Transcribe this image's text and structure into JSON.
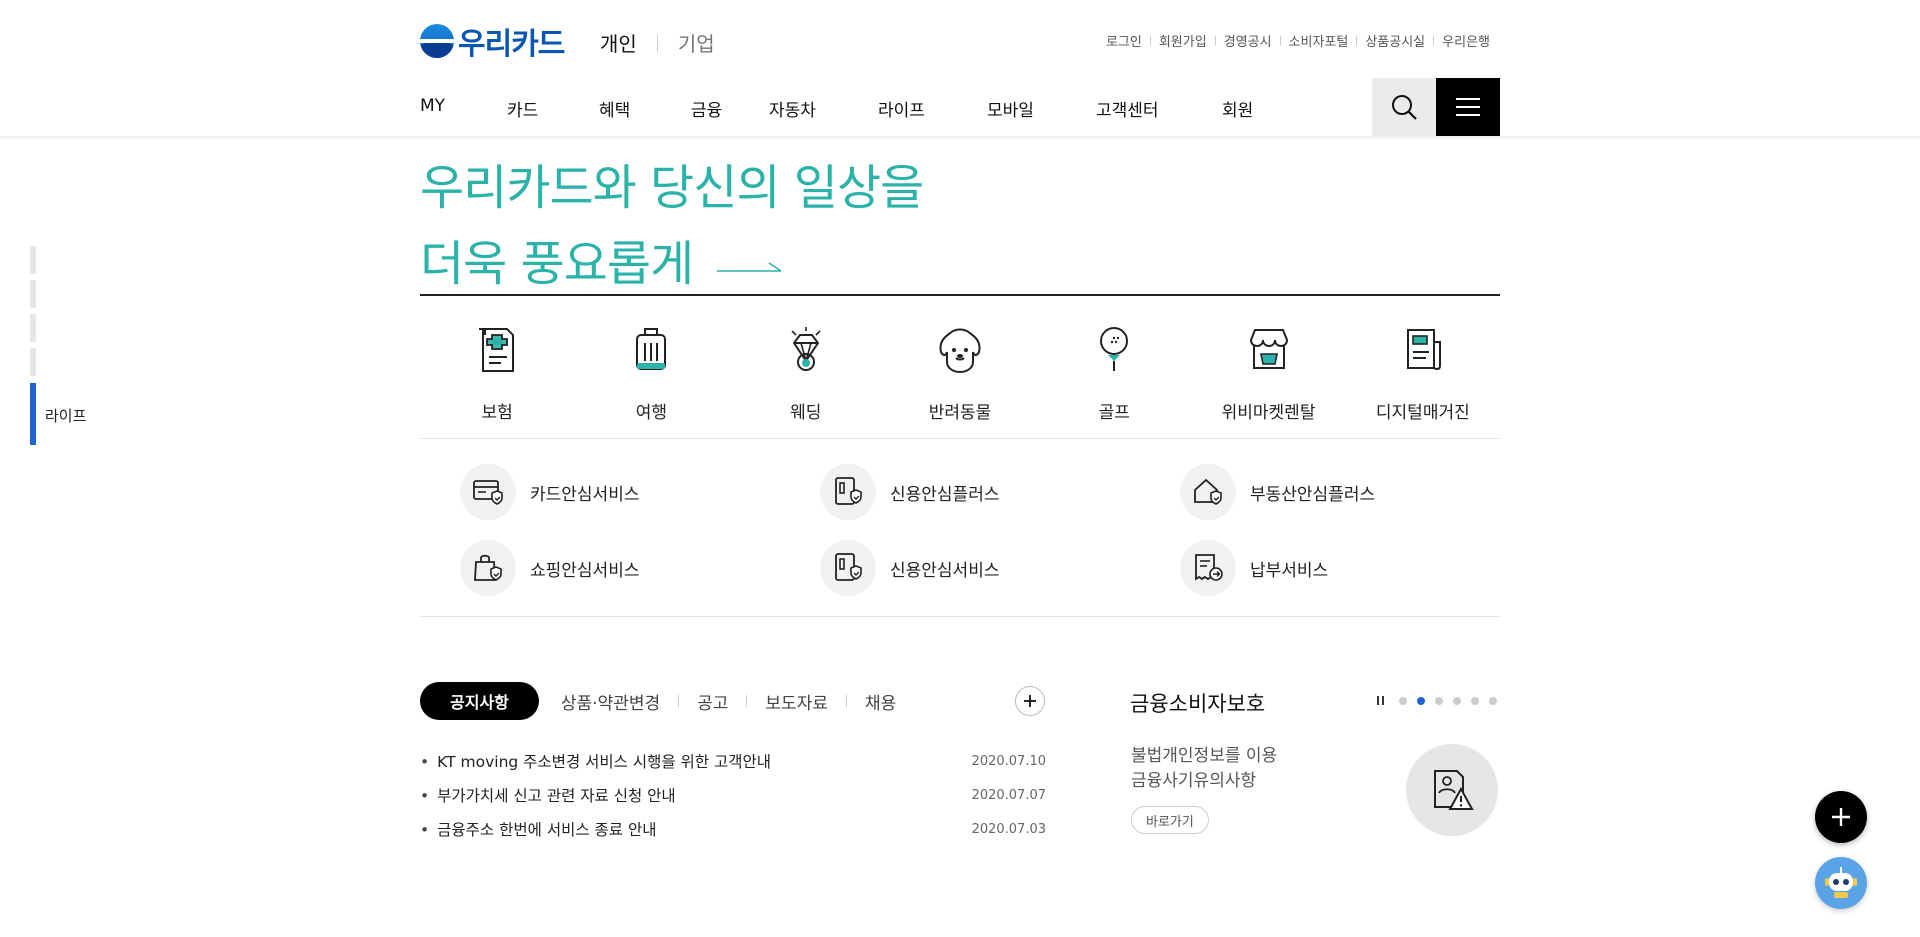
{
  "header": {
    "logo_text": "우리카드",
    "biz_tabs": {
      "personal": "개인",
      "corporate": "기업"
    },
    "util_nav": [
      "로그인",
      "회원가입",
      "경영공시",
      "소비자포털",
      "상품공시실",
      "우리은행"
    ],
    "gnb": [
      "MY",
      "카드",
      "혜택",
      "금융",
      "자동차",
      "라이프",
      "모바일",
      "고객센터",
      "회원"
    ]
  },
  "side_indicator": {
    "active_label": "라이프"
  },
  "hero": {
    "line1": "우리카드와 당신의 일상을",
    "line2": "더욱 풍요롭게"
  },
  "life_categories": [
    {
      "label": "보험",
      "icon": "insurance-doc-icon"
    },
    {
      "label": "여행",
      "icon": "suitcase-icon"
    },
    {
      "label": "웨딩",
      "icon": "diamond-ring-icon"
    },
    {
      "label": "반려동물",
      "icon": "dog-icon"
    },
    {
      "label": "골프",
      "icon": "golf-ball-icon"
    },
    {
      "label": "위비마켓렌탈",
      "icon": "market-store-icon"
    },
    {
      "label": "디지털매거진",
      "icon": "magazine-icon"
    }
  ],
  "services": [
    {
      "label": "카드안심서비스",
      "icon": "card-shield-icon"
    },
    {
      "label": "신용안심플러스",
      "icon": "credit-shield-icon"
    },
    {
      "label": "부동산안심플러스",
      "icon": "house-shield-icon"
    },
    {
      "label": "쇼핑안심서비스",
      "icon": "shopping-bag-shield-icon"
    },
    {
      "label": "신용안심서비스",
      "icon": "credit-shield-icon"
    },
    {
      "label": "납부서비스",
      "icon": "payment-doc-icon"
    }
  ],
  "notices": {
    "tabs": [
      "공지사항",
      "상품·약관변경",
      "공고",
      "보도자료",
      "채용"
    ],
    "items": [
      {
        "title": "KT moving 주소변경 서비스 시행을 위한 고객안내",
        "date": "2020.07.10"
      },
      {
        "title": "부가가치세 신고 관련 자료 신청 안내",
        "date": "2020.07.07"
      },
      {
        "title": "금융주소 한번에 서비스 종료 안내",
        "date": "2020.07.03"
      }
    ]
  },
  "consumer_protection": {
    "title": "금융소비자보호",
    "desc_line1": "불법개인정보를 이용",
    "desc_line2": "금융사기유의사항",
    "go_label": "바로가기",
    "pager_active": 2,
    "pager_total": 6
  },
  "colors": {
    "brand_blue": "#0a57b3",
    "hero_teal": "#2bb3a9",
    "indicator_blue": "#1e64d2"
  }
}
